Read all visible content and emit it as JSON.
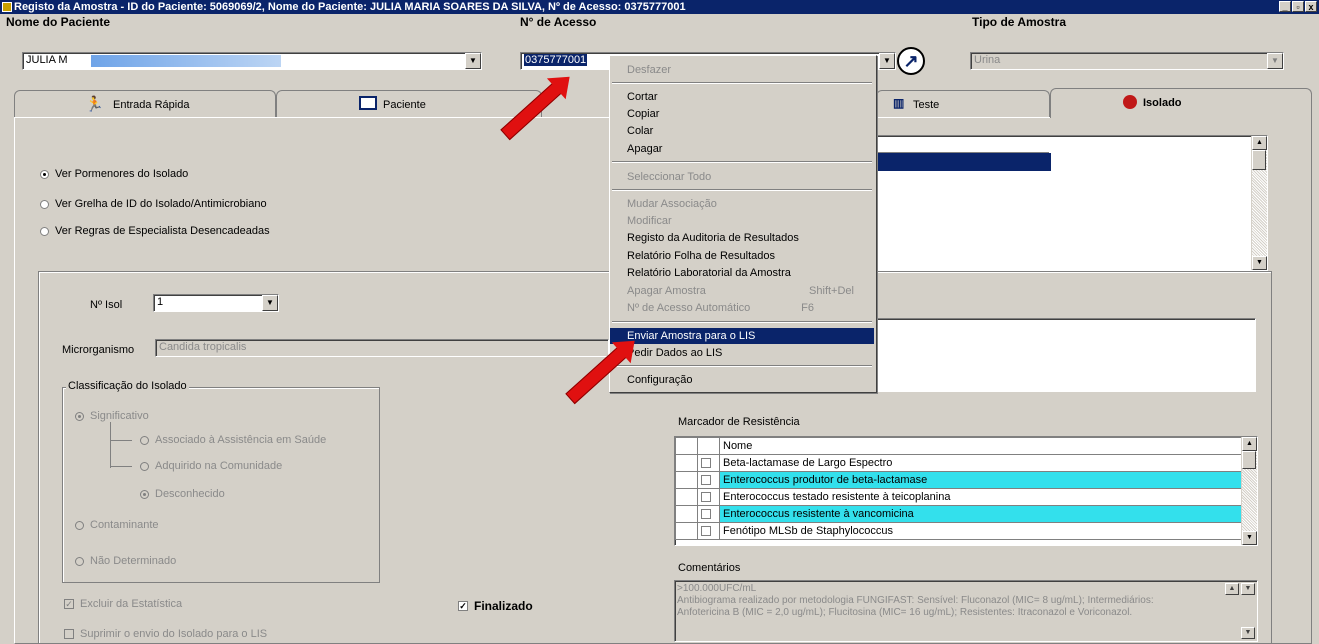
{
  "window": {
    "title": "Registo da Amostra - ID do Paciente: 5069069/2, Nome do Paciente: JULIA MARIA SOARES DA SILVA, Nº de Acesso: 0375777001",
    "btn_min": "_",
    "btn_max": "▫",
    "btn_close": "x"
  },
  "header": {
    "patient_name_label": "Nome do Paciente",
    "patient_name_value": "JULIA M",
    "accession_label": "N° de Acesso",
    "accession_value": "0375777001",
    "sample_type_label": "Tipo de Amostra",
    "sample_type_value": "Urina"
  },
  "tabs": [
    {
      "label": "Entrada Rápida"
    },
    {
      "label": "Paciente"
    },
    {
      "label": "Teste"
    },
    {
      "label": "Isolado"
    }
  ],
  "view_options": [
    {
      "label": "Ver Pormenores do Isolado",
      "selected": true
    },
    {
      "label": "Ver Grelha de ID do Isolado/Antimicrobiano",
      "selected": false
    },
    {
      "label": "Ver Regras de Especialista Desencadeadas",
      "selected": false
    }
  ],
  "isolate": {
    "num_label": "Nº Isol",
    "num_value": "1",
    "organism_label": "Microrganismo",
    "organism_value": "Candida tropicalis"
  },
  "classification": {
    "title": "Classificação do Isolado",
    "significant": "Significativo",
    "healthcare": "Associado à Assistência em Saúde",
    "community": "Adquirido na Comunidade",
    "unknown": "Desconhecido",
    "contaminant": "Contaminante",
    "undetermined": "Não Determinado"
  },
  "bottom": {
    "exclude_stats": "Excluir da Estatística",
    "finalized": "Finalizado",
    "suppress_lis": "Suprimir o envio do Isolado para o LIS"
  },
  "resistance": {
    "title": "Marcador de Resistência",
    "header_name": "Nome",
    "rows": [
      {
        "name": "Beta-lactamase de Largo Espectro",
        "highlight": false
      },
      {
        "name": "Enterococcus produtor de beta-lactamase",
        "highlight": true
      },
      {
        "name": "Enterococcus testado resistente à teicoplanina",
        "highlight": false
      },
      {
        "name": "Enterococcus resistente à vancomicina",
        "highlight": true
      },
      {
        "name": "Fenótipo MLSb de Staphylococcus",
        "highlight": false
      }
    ]
  },
  "comments": {
    "label": "Comentários",
    "line1": ">100.000UFC/mL",
    "line2": "Antibiograma realizado por metodologia FUNGIFAST: Sensível: Fluconazol (MIC= 8 ug/mL); Intermediários:",
    "line3": "Anfotericina B (MIC = 2,0 ug/mL);  Flucitosina (MIC= 16 ug/mL); Resistentes: Itraconazol e Voriconazol."
  },
  "context_menu": {
    "undo": "Desfazer",
    "cut": "Cortar",
    "copy": "Copiar",
    "paste": "Colar",
    "delete": "Apagar",
    "select_all": "Seleccionar Todo",
    "change_assoc": "Mudar Associação",
    "modify": "Modificar",
    "audit": "Registo da Auditoria de Resultados",
    "result_sheet": "Relatório Folha de Resultados",
    "lab_report": "Relatório Laboratorial da Amostra",
    "delete_sample": "Apagar Amostra",
    "delete_sample_sc": "Shift+Del",
    "auto_accession": "Nº de Acesso Automático",
    "auto_accession_sc": "F6",
    "send_lis": "Enviar Amostra para o LIS",
    "request_lis": "Pedir Dados ao LIS",
    "config": "Configuração"
  },
  "colors": {
    "titlebar": "#0a246a",
    "selection": "#0a246a",
    "highlight_row": "#33e0ec",
    "arrow": "#e01010"
  }
}
